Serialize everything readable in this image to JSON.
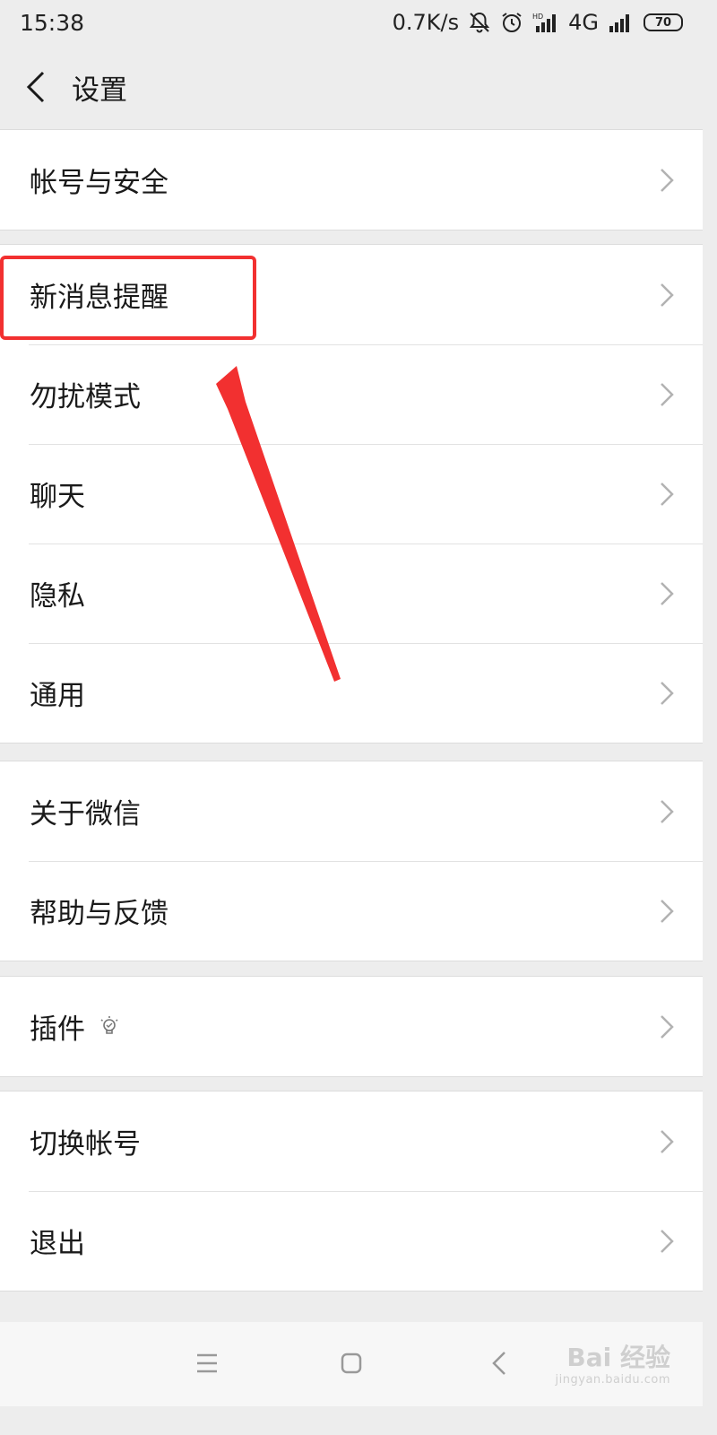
{
  "status_bar": {
    "time": "15:38",
    "net_speed": "0.7K/s",
    "network_type": "4G",
    "battery": "70",
    "icons": [
      "bell-muted-icon",
      "alarm-icon",
      "hd-signal-icon",
      "signal-icon"
    ]
  },
  "header": {
    "back_icon": "chevron-left-icon",
    "title": "设置"
  },
  "groups": [
    {
      "items": [
        {
          "label": "帐号与安全"
        }
      ]
    },
    {
      "items": [
        {
          "label": "新消息提醒"
        },
        {
          "label": "勿扰模式"
        },
        {
          "label": "聊天"
        },
        {
          "label": "隐私"
        },
        {
          "label": "通用"
        }
      ]
    },
    {
      "items": [
        {
          "label": "关于微信"
        },
        {
          "label": "帮助与反馈"
        }
      ]
    },
    {
      "items": [
        {
          "label": "插件",
          "icon": "lightbulb-icon"
        }
      ]
    },
    {
      "items": [
        {
          "label": "切换帐号"
        },
        {
          "label": "退出"
        }
      ]
    }
  ],
  "nav_bar": {
    "icons": [
      "menu-icon",
      "home-icon",
      "back-icon"
    ]
  },
  "annotation": {
    "highlight_color": "#f23030"
  },
  "watermark": {
    "brand": "Bai 经验",
    "url": "jingyan.baidu.com"
  }
}
